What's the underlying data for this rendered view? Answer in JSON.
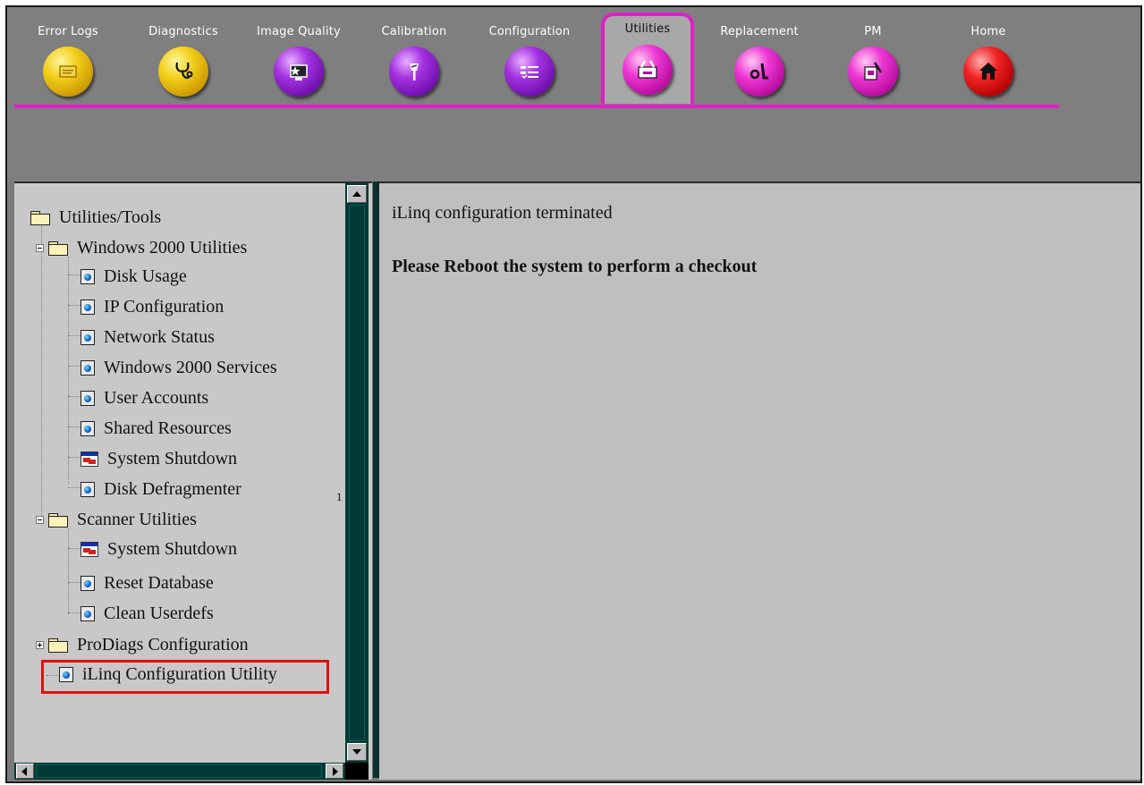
{
  "toolbar": {
    "tabs": [
      {
        "label": "Error Logs",
        "icon": "error-logs-icon",
        "color": "#f2cf1a"
      },
      {
        "label": "Diagnostics",
        "icon": "stethoscope-icon",
        "color": "#f2cf1a"
      },
      {
        "label": "Image Quality",
        "icon": "image-quality-icon",
        "color": "#a432e0"
      },
      {
        "label": "Calibration",
        "icon": "calibration-icon",
        "color": "#a432e0"
      },
      {
        "label": "Configuration",
        "icon": "configuration-icon",
        "color": "#a432e0"
      },
      {
        "label": "Utilities",
        "icon": "utilities-toolbox-icon",
        "color": "#ee38d4",
        "active": true
      },
      {
        "label": "Replacement",
        "icon": "replacement-icon",
        "color": "#ee38d4"
      },
      {
        "label": "PM",
        "icon": "pm-icon",
        "color": "#ee38d4"
      },
      {
        "label": "Home",
        "icon": "home-icon",
        "color": "#f02424"
      }
    ],
    "active_color": "#e020c8"
  },
  "tree": {
    "root": "Utilities/Tools",
    "groups": [
      {
        "label": "Windows 2000 Utilities",
        "expanded": true,
        "items": [
          "Disk Usage",
          "IP Configuration",
          "Network Status",
          "Windows 2000 Services",
          "User Accounts",
          "Shared Resources",
          "System Shutdown",
          "Disk Defragmenter"
        ]
      },
      {
        "label": "Scanner Utilities",
        "expanded": true,
        "items": [
          "System Shutdown",
          "Reset Database",
          "Clean Userdefs"
        ]
      },
      {
        "label": "ProDiags Configuration",
        "expanded": false,
        "items": []
      }
    ],
    "selected": "iLinq Configuration Utility",
    "stray_mark": "1"
  },
  "content": {
    "message": "iLinq configuration terminated",
    "instruction": "Please Reboot the system to perform a checkout"
  }
}
